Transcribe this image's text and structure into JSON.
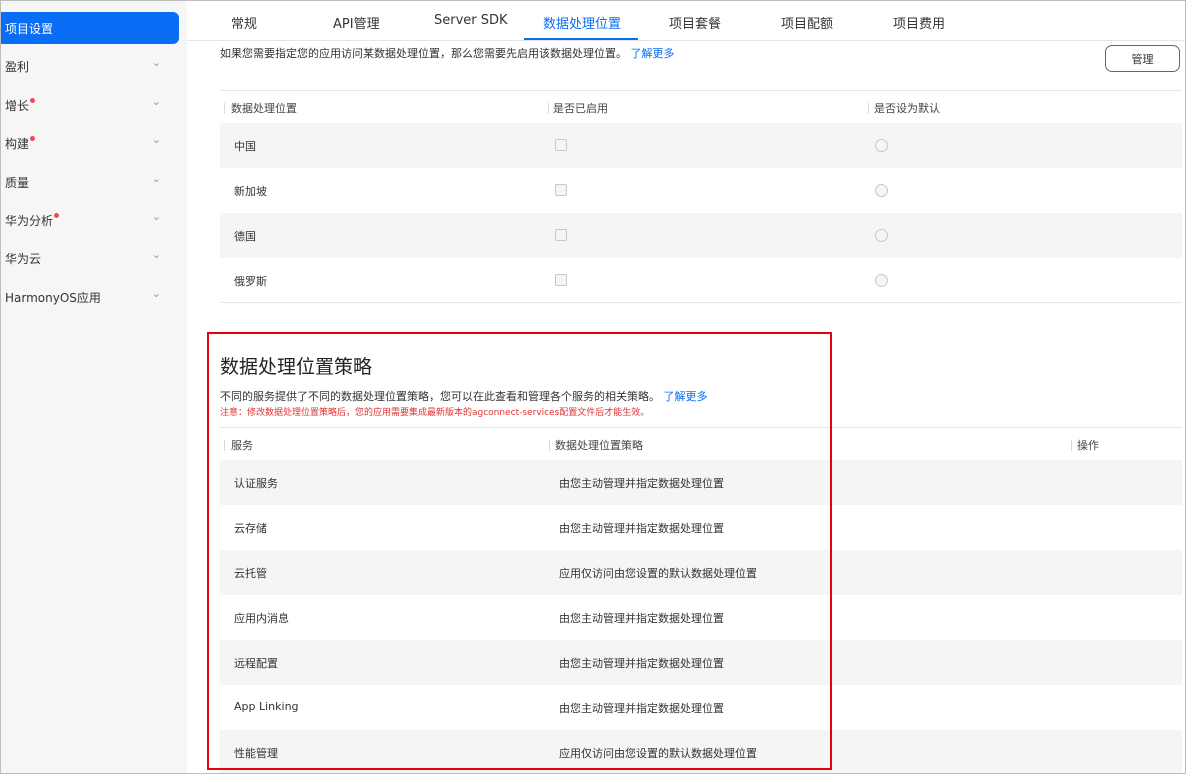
{
  "sidebar": {
    "items": [
      {
        "label": "项目设置",
        "active": true,
        "badge": false
      },
      {
        "label": "盈利",
        "badge": false
      },
      {
        "label": "增长",
        "badge": true
      },
      {
        "label": "构建",
        "badge": true
      },
      {
        "label": "质量",
        "badge": false
      },
      {
        "label": "华为分析",
        "badge": true
      },
      {
        "label": "华为云",
        "badge": false
      },
      {
        "label": "HarmonyOS应用",
        "badge": false
      }
    ],
    "chevron": "⌄"
  },
  "tabs": [
    "常规",
    "API管理",
    "Server SDK",
    "数据处理位置",
    "项目套餐",
    "项目配额",
    "项目费用"
  ],
  "active_tab": "数据处理位置",
  "intro": {
    "text": "如果您需要指定您的应用访问某数据处理位置，那么您需要先启用该数据处理位置。",
    "link": "了解更多"
  },
  "manage_button": "管理",
  "locations_table": {
    "headers": [
      "数据处理位置",
      "是否已启用",
      "是否设为默认"
    ],
    "rows": [
      "中国",
      "新加坡",
      "德国",
      "俄罗斯"
    ]
  },
  "policy": {
    "title": "数据处理位置策略",
    "desc": "不同的服务提供了不同的数据处理位置策略，您可以在此查看和管理各个服务的相关策略。",
    "link": "了解更多",
    "note": "注意：修改数据处理位置策略后，您的应用需要集成最新版本的agconnect-services配置文件后才能生效。",
    "headers": [
      "服务",
      "数据处理位置策略",
      "操作"
    ],
    "rows": [
      {
        "service": "认证服务",
        "policy": "由您主动管理并指定数据处理位置"
      },
      {
        "service": "云存储",
        "policy": "由您主动管理并指定数据处理位置"
      },
      {
        "service": "云托管",
        "policy": "应用仅访问由您设置的默认数据处理位置"
      },
      {
        "service": "应用内消息",
        "policy": "由您主动管理并指定数据处理位置"
      },
      {
        "service": "远程配置",
        "policy": "由您主动管理并指定数据处理位置"
      },
      {
        "service": "App Linking",
        "policy": "由您主动管理并指定数据处理位置"
      },
      {
        "service": "性能管理",
        "policy": "应用仅访问由您设置的默认数据处理位置"
      }
    ]
  },
  "colors": {
    "accent": "#0a6df5",
    "badge": "#e84e5a",
    "annotation": "#e60012",
    "note": "#e23232"
  }
}
